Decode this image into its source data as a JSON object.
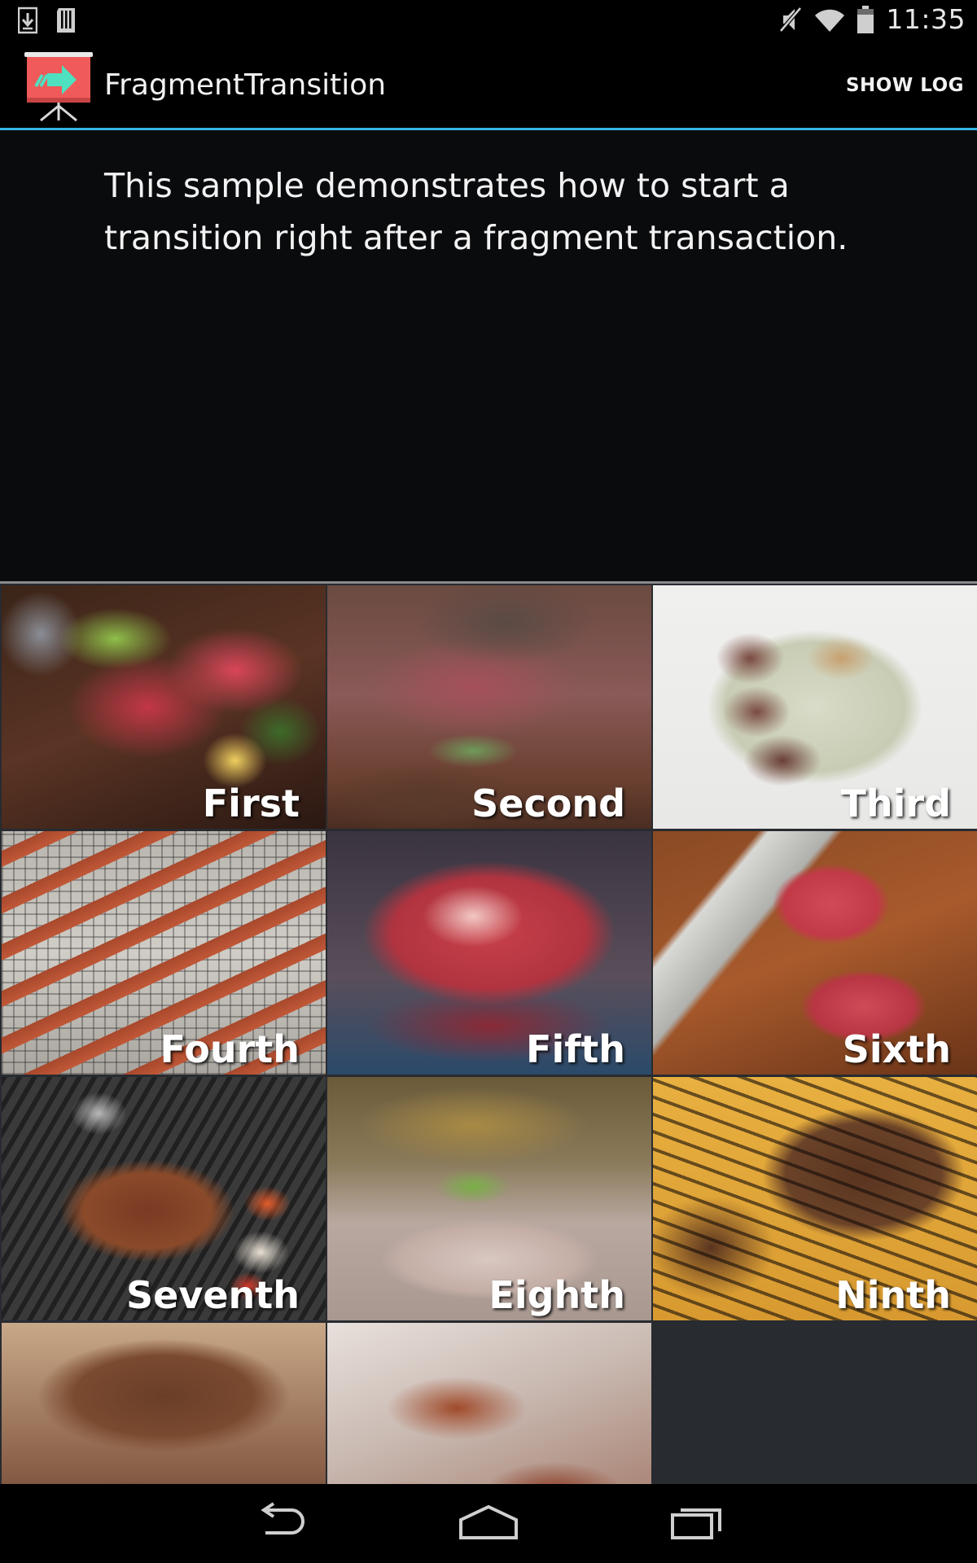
{
  "status_bar": {
    "time": "11:35",
    "left_icons": [
      "download-icon",
      "sd-card-icon"
    ],
    "right_icons": [
      "mute-icon",
      "wifi-icon",
      "battery-icon"
    ]
  },
  "action_bar": {
    "app_title": "FragmentTransition",
    "show_log_label": "SHOW LOG",
    "accent_color": "#33b5e5"
  },
  "description": "This sample demonstrates how to start a transition right after a fragment transaction.",
  "grid": {
    "items": [
      {
        "label": "First"
      },
      {
        "label": "Second"
      },
      {
        "label": "Third"
      },
      {
        "label": "Fourth"
      },
      {
        "label": "Fifth"
      },
      {
        "label": "Sixth"
      },
      {
        "label": "Seventh"
      },
      {
        "label": "Eighth"
      },
      {
        "label": "Ninth"
      },
      {
        "label": ""
      },
      {
        "label": ""
      }
    ]
  },
  "nav_bar": {
    "buttons": [
      "back-icon",
      "home-icon",
      "recents-icon"
    ]
  }
}
